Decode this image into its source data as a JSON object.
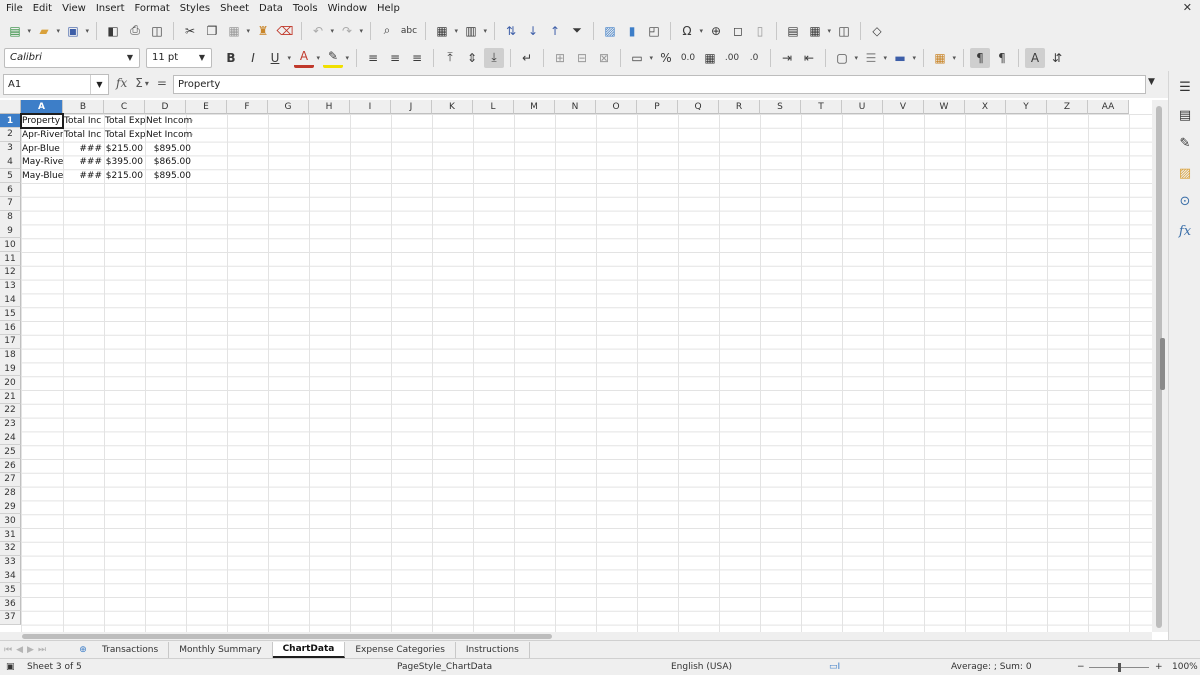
{
  "menu": [
    "File",
    "Edit",
    "View",
    "Insert",
    "Format",
    "Styles",
    "Sheet",
    "Data",
    "Tools",
    "Window",
    "Help"
  ],
  "font": {
    "name": "Calibri",
    "size": "11 pt"
  },
  "format_buttons": {
    "bold": "B",
    "italic": "I",
    "underline": "U"
  },
  "namebox": "A1",
  "formula": "Property",
  "formula_symbols": {
    "fx": "fx",
    "sigma": "Σ",
    "equals": "="
  },
  "columns": [
    "A",
    "B",
    "C",
    "D",
    "E",
    "F",
    "G",
    "H",
    "I",
    "J",
    "K",
    "L",
    "M",
    "N",
    "O",
    "P",
    "Q",
    "R",
    "S",
    "T",
    "U",
    "V",
    "W",
    "X",
    "Y",
    "Z",
    "AA"
  ],
  "rows": [
    "1",
    "2",
    "3",
    "4",
    "5",
    "6",
    "7",
    "8",
    "9",
    "10",
    "11",
    "12",
    "13",
    "14",
    "15",
    "16",
    "17",
    "18",
    "19",
    "20",
    "21",
    "22",
    "23",
    "24",
    "25",
    "26",
    "27",
    "28",
    "29",
    "30",
    "31",
    "32",
    "33",
    "34",
    "35",
    "36",
    "37"
  ],
  "cells": {
    "r1": [
      "Property",
      "Total Inc",
      "Total Exp",
      "Net Income"
    ],
    "r2": [
      "Apr-River",
      "Total Inc",
      "Total Exp",
      "Net Income"
    ],
    "r3": [
      "Apr-Blue",
      "###",
      "$215.00",
      "$895.00"
    ],
    "r4": [
      "May-River",
      "###",
      "$395.00",
      "$865.00"
    ],
    "r5": [
      "May-Blue",
      "###",
      "$215.00",
      "$895.00"
    ]
  },
  "tabs": [
    "Transactions",
    "Monthly Summary",
    "ChartData",
    "Expense Categories",
    "Instructions"
  ],
  "status": {
    "sheet": "Sheet 3 of 5",
    "page_style": "PageStyle_ChartData",
    "language": "English (USA)",
    "summary": "Average: ; Sum: 0",
    "zoom": "100%"
  }
}
